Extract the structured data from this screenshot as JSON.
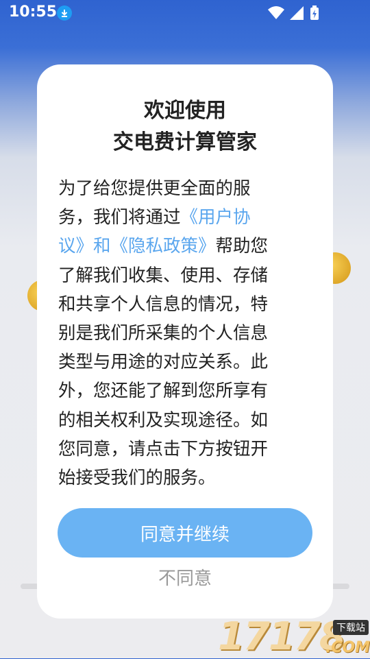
{
  "status_bar": {
    "time": "10:55",
    "icons": [
      "download-icon",
      "wifi-icon",
      "signal-icon",
      "battery-charging-icon"
    ]
  },
  "dialog": {
    "title_line1": "欢迎使用",
    "title_line2": "交电费计算管家",
    "body_lines": [
      "为了给您提供更全面的服",
      "务，我们将通过",
      "议》和",
      "帮助您",
      "了解我们收集、使用、存储",
      "和共享个人信息的情况，特",
      "别是我们所采集的个人信息",
      "类型与用途的对应关系。此",
      "外，您还能了解到您所享有",
      "的相关权利及实现途径。如",
      "您同意，请点击下方按钮开",
      "始接受我们的服务。"
    ],
    "link_user_agreement_part1": "《用户协",
    "link_privacy_policy": "《隐私政策》",
    "agree_button": "同意并继续",
    "disagree_button": "不同意"
  },
  "watermark": {
    "number": "17178",
    "tag": "下载站",
    "domain": ".COM"
  },
  "colors": {
    "link": "#5aa6ee",
    "button": "#6ab3f3",
    "header_blue": "#2f63d0"
  }
}
